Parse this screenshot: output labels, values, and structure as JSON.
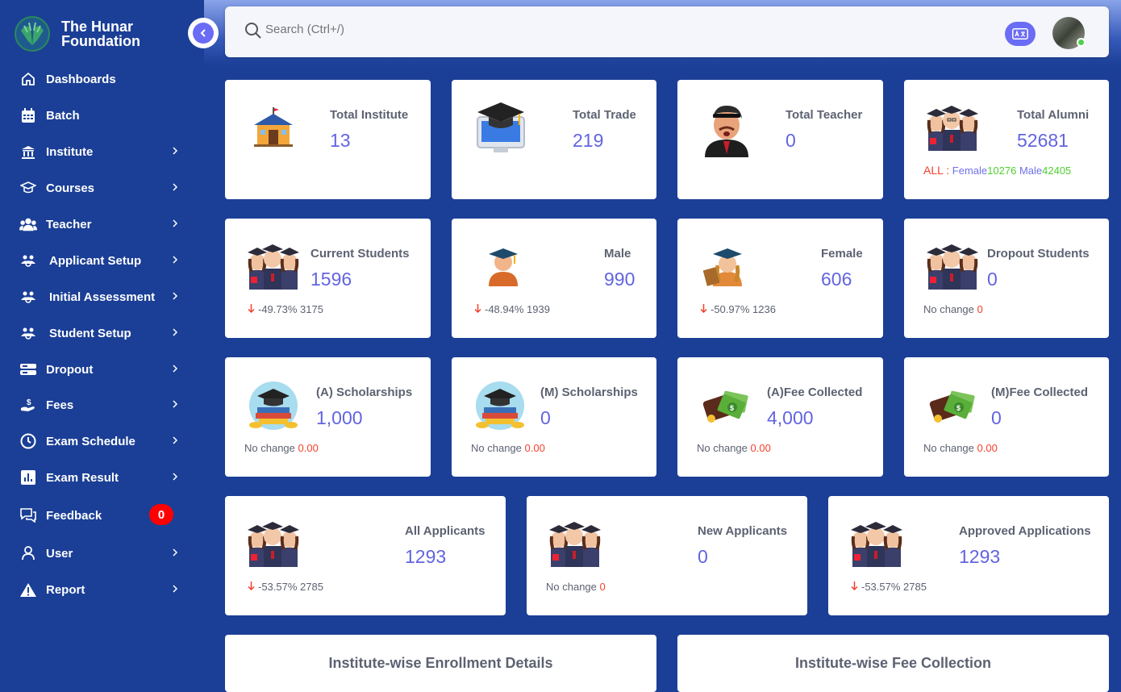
{
  "brand": {
    "name_line1": "The Hunar",
    "name_line2": "Foundation",
    "logo": "hands-logo-icon"
  },
  "sidebar": {
    "items": [
      {
        "label": "Dashboards",
        "icon": "home-icon",
        "chevron": false
      },
      {
        "label": "Batch",
        "icon": "calendar-icon",
        "chevron": false
      },
      {
        "label": "Institute",
        "icon": "bank-icon",
        "chevron": true
      },
      {
        "label": "Courses",
        "icon": "graduation-cap-icon",
        "chevron": true
      },
      {
        "label": "Teacher",
        "icon": "users-icon",
        "chevron": true
      },
      {
        "label": "Applicant Setup",
        "icon": "people-gear-icon",
        "chevron": true
      },
      {
        "label": "Initial Assessment",
        "icon": "people-gear-icon",
        "chevron": true
      },
      {
        "label": "Student Setup",
        "icon": "people-gear-icon",
        "chevron": true
      },
      {
        "label": "Dropout",
        "icon": "server-icon",
        "chevron": true
      },
      {
        "label": "Fees",
        "icon": "hand-coin-icon",
        "chevron": true
      },
      {
        "label": "Exam Schedule",
        "icon": "clock-icon",
        "chevron": true
      },
      {
        "label": "Exam Result",
        "icon": "bar-chart-icon",
        "chevron": true
      },
      {
        "label": "Feedback",
        "icon": "chat-icon",
        "chevron": false,
        "badge": "0"
      },
      {
        "label": "User",
        "icon": "user-icon",
        "chevron": true
      },
      {
        "label": "Report",
        "icon": "warning-icon",
        "chevron": true
      }
    ]
  },
  "header": {
    "search_placeholder": "Search (Ctrl+/)"
  },
  "stats_row1": [
    {
      "title": "Total Institute",
      "value": "13",
      "icon": "school-building-icon"
    },
    {
      "title": "Total Trade",
      "value": "219",
      "icon": "monitor-grad-cap-icon"
    },
    {
      "title": "Total Teacher",
      "value": "0",
      "icon": "teacher-avatar-icon"
    },
    {
      "title": "Total Alumni",
      "value": "52681",
      "icon": "students-group-icon",
      "all_label": "ALL :",
      "female_label": "Female",
      "female_value": "10276",
      "male_label": "Male",
      "male_value": "42405"
    }
  ],
  "stats_row2": [
    {
      "title": "Current Students",
      "value": "1596",
      "icon": "students-group-icon",
      "change": "-49.73%",
      "prev": "3175"
    },
    {
      "title": "Male",
      "value": "990",
      "icon": "male-graduate-icon",
      "change": "-48.94%",
      "prev": "1939"
    },
    {
      "title": "Female",
      "value": "606",
      "icon": "female-graduate-icon",
      "change": "-50.97%",
      "prev": "1236"
    },
    {
      "title": "Dropout Students",
      "value": "0",
      "icon": "students-group-icon",
      "note": "No change",
      "note_value": "0"
    }
  ],
  "stats_row3": [
    {
      "title": "(A) Scholarships",
      "value": "1,000",
      "icon": "scholarship-icon",
      "note": "No change",
      "note_value": "0.00"
    },
    {
      "title": "(M) Scholarships",
      "value": "0",
      "icon": "scholarship-icon",
      "note": "No change",
      "note_value": "0.00"
    },
    {
      "title": "(A)Fee Collected",
      "value": "4,000",
      "icon": "wallet-money-icon",
      "note": "No change",
      "note_value": "0.00"
    },
    {
      "title": "(M)Fee Collected",
      "value": "0",
      "icon": "wallet-money-icon",
      "note": "No change",
      "note_value": "0.00"
    }
  ],
  "stats_row4": [
    {
      "title": "All Applicants",
      "value": "1293",
      "icon": "students-group-icon",
      "change": "-53.57%",
      "prev": "2785"
    },
    {
      "title": "New Applicants",
      "value": "0",
      "icon": "students-group-icon",
      "note": "No change",
      "note_value": "0"
    },
    {
      "title": "Approved Applications",
      "value": "1293",
      "icon": "students-group-icon",
      "change": "-53.57%",
      "prev": "2785"
    }
  ],
  "panels": [
    {
      "title": "Institute-wise Enrollment Details"
    },
    {
      "title": "Institute-wise Fee Collection"
    }
  ],
  "colors": {
    "sidebar_bg": "#1b3f96",
    "accent": "#6264e0",
    "negative": "#f5402c",
    "positive": "#4fcf2f"
  }
}
